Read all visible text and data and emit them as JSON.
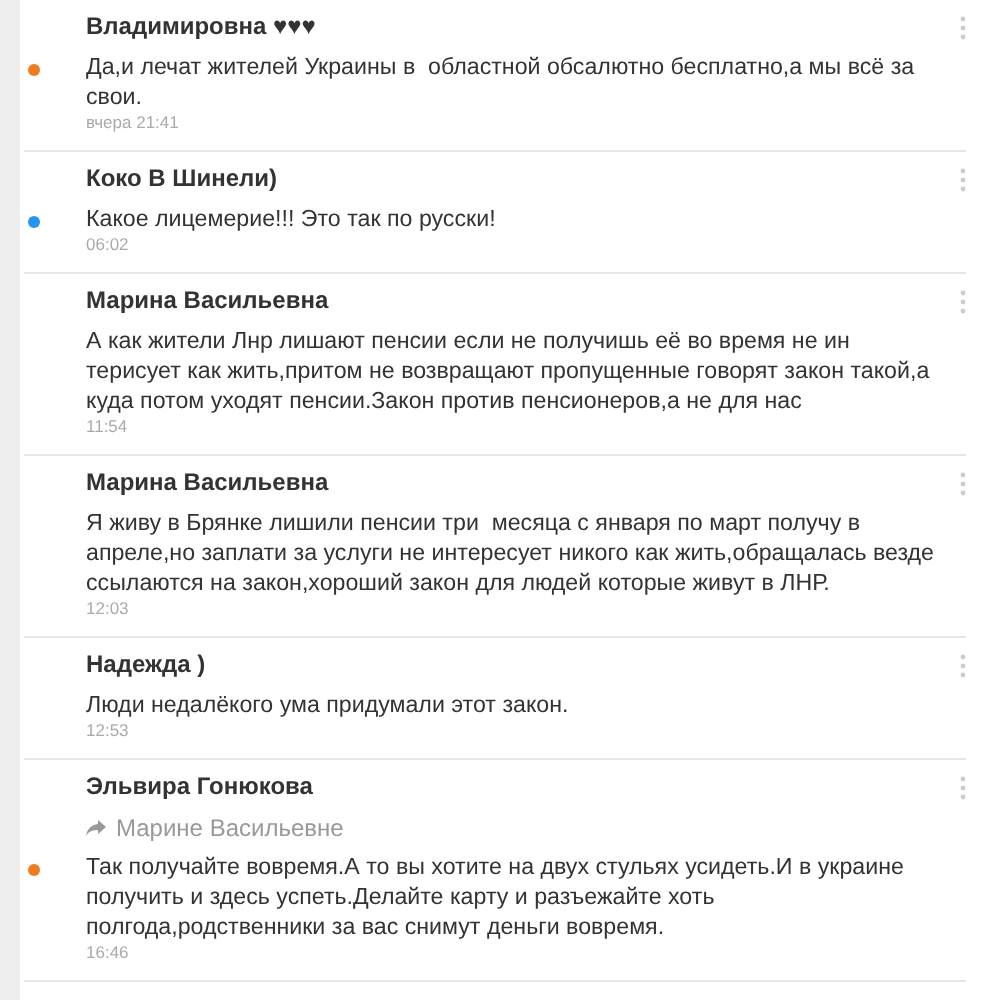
{
  "comments": [
    {
      "author": "Владимировна ♥♥♥",
      "color": "#f07c1f",
      "text": "Да,и лечат жителей Украины в  областной обсалютно бесплатно,а мы всё за свои.",
      "time": "вчера 21:41"
    },
    {
      "author": "Коко В Шинели)",
      "color": "#2196f3",
      "text": "Какое лицемерие!!! Это так по русски!",
      "time": "06:02"
    },
    {
      "author": "Марина Васильевна",
      "text": "А как жители Лнр лишают пенсии если не получишь её во время не ин терисует как жить,притом не возвращают пропущенные говорят закон такой,а куда потом уходят пенсии.Закон против пенсионеров,а не для нас",
      "time": "11:54"
    },
    {
      "author": "Марина Васильевна",
      "text": "Я живу в Брянке лишили пенсии три  месяца с января по март получу в апреле,но заплати за услуги не интересует никого как жить,обращалась везде ссылаются на закон,хороший закон для людей которые живут в ЛНР.",
      "time": "12:03"
    },
    {
      "author": "Надежда )",
      "text": "Люди недалёкого ума придумали этот закон.",
      "time": "12:53"
    },
    {
      "author": "Эльвира Гонюкова",
      "color": "#f07c1f",
      "reply_to": "Марине Васильевне",
      "text": "Так получайте вовремя.А то вы хотите на двух стульях усидеть.И в украине получить и здесь успеть.Делайте карту и разъежайте хоть полгода,родственники за вас снимут деньги вовремя.",
      "time": "16:46"
    }
  ]
}
